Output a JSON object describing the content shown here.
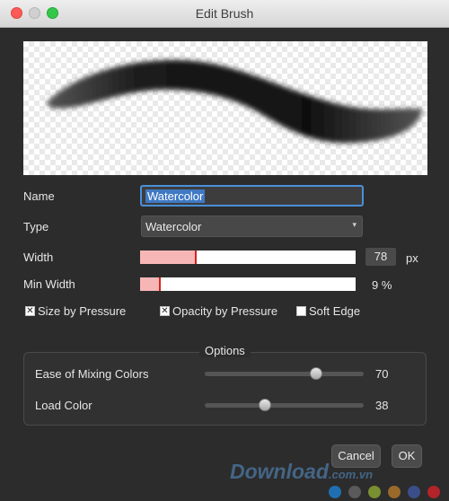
{
  "window": {
    "title": "Edit Brush"
  },
  "form": {
    "name_label": "Name",
    "name_value": "Watercolor",
    "type_label": "Type",
    "type_value": "Watercolor",
    "width_label": "Width",
    "width_value": "78",
    "width_unit": "px",
    "width_level": 0.26,
    "min_width_label": "Min Width",
    "min_width_value": "9 %",
    "min_width_level": 0.09
  },
  "checkboxes": [
    {
      "label": "Size by Pressure",
      "checked": true
    },
    {
      "label": "Opacity by Pressure",
      "checked": true
    },
    {
      "label": "Soft Edge",
      "checked": false
    }
  ],
  "options": {
    "title": "Options",
    "ease_label": "Ease of Mixing Colors",
    "ease_value": "70",
    "ease_level": 0.7,
    "load_label": "Load Color",
    "load_value": "38",
    "load_level": 0.38
  },
  "buttons": {
    "cancel": "Cancel",
    "ok": "OK"
  },
  "watermark": {
    "text": "Download",
    "suffix": ".com.vn"
  },
  "colors": {
    "accent": "#4a8fd9",
    "slider_fill": "#f7b6b6",
    "slider_marker": "#d6231f",
    "dots": [
      "#1f6fb2",
      "#5a5a5a",
      "#7a8f2f",
      "#9a6a2a",
      "#3a4f8a",
      "#b2232a"
    ]
  }
}
